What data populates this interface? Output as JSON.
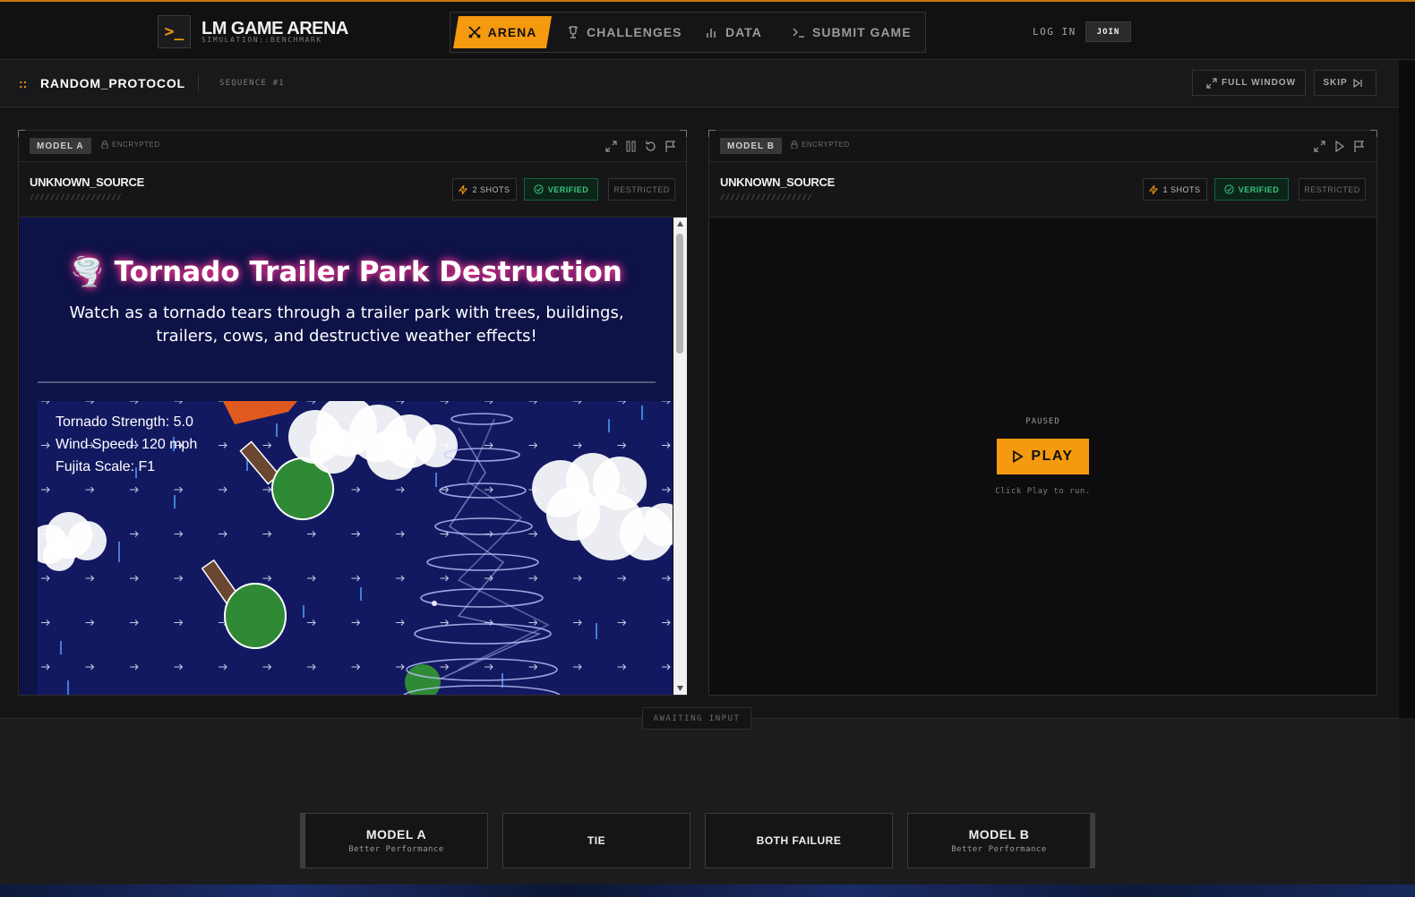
{
  "brand": {
    "logo_glyph": ">_",
    "title": "LM GAME ARENA",
    "subtitle": "SIMULATION::BENCHMARK",
    "accent": "#f59a0e"
  },
  "nav": {
    "arena": "ARENA",
    "challenges": "CHALLENGES",
    "data": "DATA",
    "submit": "SUBMIT GAME"
  },
  "auth": {
    "login": "LOG IN",
    "join": "JOIN"
  },
  "protocol": {
    "dots": "::",
    "title": "RANDOM_PROTOCOL",
    "sequence": "SEQUENCE #1",
    "full_window": "FULL WINDOW",
    "skip": "SKIP"
  },
  "panel_a": {
    "tag": "MODEL A",
    "encrypted": "ENCRYPTED",
    "source": "UNKNOWN_SOURCE",
    "slashes": "//////////////////",
    "shots": "2 SHOTS",
    "verified": "VERIFIED",
    "restricted": "RESTRICTED",
    "game": {
      "title": "🌪️ Tornado Trailer Park Destruction",
      "description": "Watch as a tornado tears through a trailer park with trees, buildings, trailers, cows, and destructive weather effects!",
      "hud": [
        "Tornado Strength: 5.0",
        "Wind Speed: 120 mph",
        "Fujita Scale: F1"
      ]
    }
  },
  "panel_b": {
    "tag": "MODEL B",
    "encrypted": "ENCRYPTED",
    "source": "UNKNOWN_SOURCE",
    "slashes": "//////////////////",
    "shots": "1 SHOTS",
    "verified": "VERIFIED",
    "restricted": "RESTRICTED",
    "paused": "PAUSED",
    "play": "PLAY",
    "hint": "Click Play to run."
  },
  "status": {
    "awaiting": "AWAITING INPUT"
  },
  "votes": {
    "model_a": {
      "label": "MODEL A",
      "sub": "Better Performance"
    },
    "tie": {
      "label": "TIE"
    },
    "both": {
      "label": "BOTH FAILURE"
    },
    "model_b": {
      "label": "MODEL B",
      "sub": "Better Performance"
    }
  }
}
